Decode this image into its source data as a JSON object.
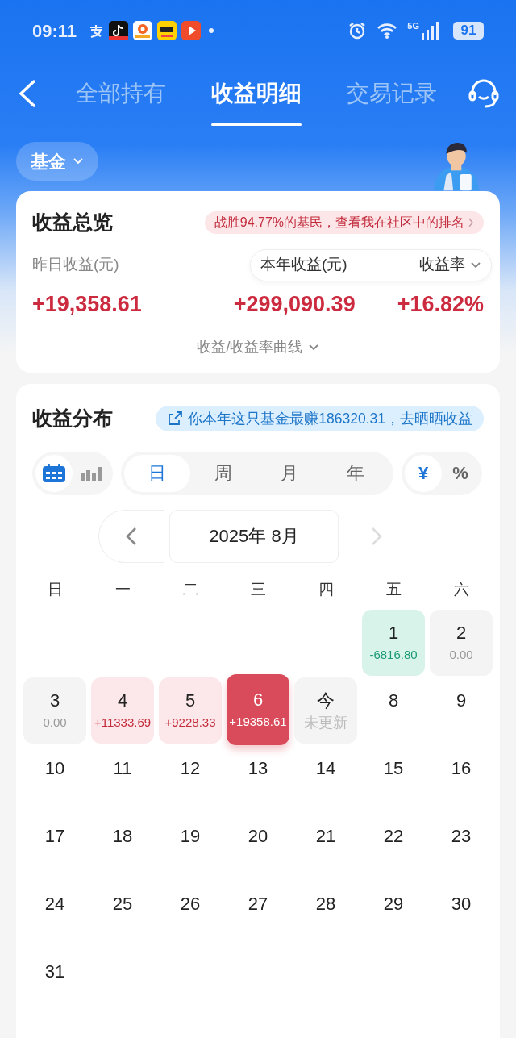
{
  "status_bar": {
    "time": "09:11",
    "network": "5G",
    "battery": "91"
  },
  "nav": {
    "tabs": [
      {
        "label": "全部持有",
        "selected": false
      },
      {
        "label": "收益明细",
        "selected": true
      },
      {
        "label": "交易记录",
        "selected": false
      }
    ]
  },
  "filter": {
    "label": "基金"
  },
  "overview": {
    "title": "收益总览",
    "rank_banner": "战胜94.77%的基民，查看我在社区中的排名",
    "metrics": [
      {
        "label": "昨日收益(元)",
        "value": "+19,358.61"
      },
      {
        "label": "本年收益(元)",
        "value": "+299,090.39"
      },
      {
        "label": "收益率",
        "value": "+16.82%"
      }
    ],
    "curve_toggle": "收益/收益率曲线"
  },
  "distribution": {
    "title": "收益分布",
    "share_banner": "你本年这只基金最赚186320.31，去晒晒收益",
    "view_modes": [
      {
        "kind": "calendar",
        "selected": true
      },
      {
        "kind": "bars",
        "selected": false
      }
    ],
    "periods": [
      {
        "label": "日",
        "selected": true
      },
      {
        "label": "周",
        "selected": false
      },
      {
        "label": "月",
        "selected": false
      },
      {
        "label": "年",
        "selected": false
      }
    ],
    "units": [
      {
        "label": "¥",
        "selected": true
      },
      {
        "label": "%",
        "selected": false
      }
    ],
    "month": "2025年 8月",
    "next_disabled": true,
    "weekdays": [
      "日",
      "一",
      "二",
      "三",
      "四",
      "五",
      "六"
    ],
    "weeks": [
      [
        {
          "kind": "empty"
        },
        {
          "kind": "empty"
        },
        {
          "kind": "empty"
        },
        {
          "kind": "empty"
        },
        {
          "kind": "empty"
        },
        {
          "day": "1",
          "amount": "-6816.80",
          "kind": "loss"
        },
        {
          "day": "2",
          "amount": "0.00",
          "kind": "zero"
        }
      ],
      [
        {
          "day": "3",
          "amount": "0.00",
          "kind": "zero"
        },
        {
          "day": "4",
          "amount": "+11333.69",
          "kind": "gain"
        },
        {
          "day": "5",
          "amount": "+9228.33",
          "kind": "gain"
        },
        {
          "day": "6",
          "amount": "+19358.61",
          "kind": "selected"
        },
        {
          "day": "今",
          "amount": "未更新",
          "kind": "today"
        },
        {
          "day": "8",
          "kind": "plain"
        },
        {
          "day": "9",
          "kind": "plain"
        }
      ],
      [
        {
          "day": "10",
          "kind": "plain"
        },
        {
          "day": "11",
          "kind": "plain"
        },
        {
          "day": "12",
          "kind": "plain"
        },
        {
          "day": "13",
          "kind": "plain"
        },
        {
          "day": "14",
          "kind": "plain"
        },
        {
          "day": "15",
          "kind": "plain"
        },
        {
          "day": "16",
          "kind": "plain"
        }
      ],
      [
        {
          "day": "17",
          "kind": "plain"
        },
        {
          "day": "18",
          "kind": "plain"
        },
        {
          "day": "19",
          "kind": "plain"
        },
        {
          "day": "20",
          "kind": "plain"
        },
        {
          "day": "21",
          "kind": "plain"
        },
        {
          "day": "22",
          "kind": "plain"
        },
        {
          "day": "23",
          "kind": "plain"
        }
      ],
      [
        {
          "day": "24",
          "kind": "plain"
        },
        {
          "day": "25",
          "kind": "plain"
        },
        {
          "day": "26",
          "kind": "plain"
        },
        {
          "day": "27",
          "kind": "plain"
        },
        {
          "day": "28",
          "kind": "plain"
        },
        {
          "day": "29",
          "kind": "plain"
        },
        {
          "day": "30",
          "kind": "plain"
        }
      ],
      [
        {
          "day": "31",
          "kind": "plain"
        },
        {
          "kind": "empty"
        },
        {
          "kind": "empty"
        },
        {
          "kind": "empty"
        },
        {
          "kind": "empty"
        },
        {
          "kind": "empty"
        },
        {
          "kind": "empty"
        }
      ]
    ]
  }
}
